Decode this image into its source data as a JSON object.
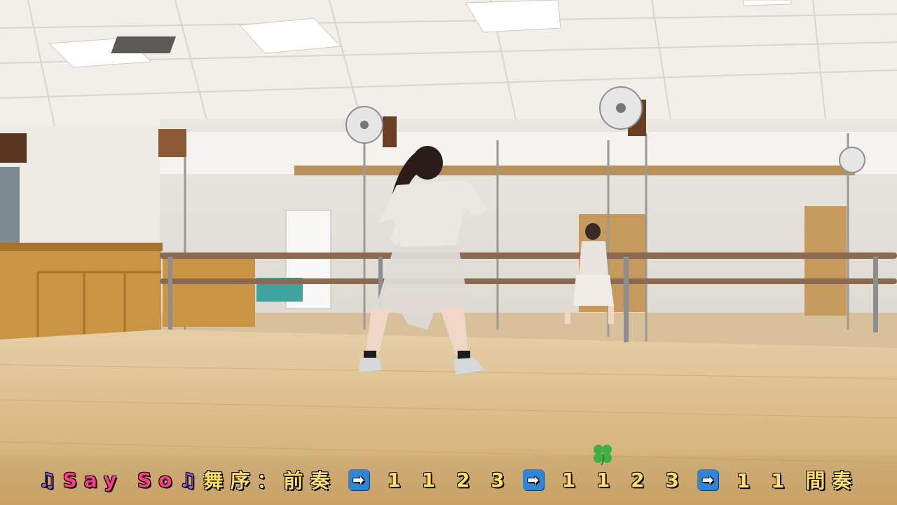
{
  "colors": {
    "ceiling": "#f1efe9",
    "wall": "#ecebe6",
    "floor": "#d9b986",
    "counter": "#c99545",
    "barre": "#8a6a50",
    "caption_text": "#ffe066",
    "caption_title": "#ff3b8a",
    "caption_note": "#9b59e6",
    "arrow_badge": "#2f86d6"
  },
  "icons": [
    "music-note-icon",
    "arrow-right-icon",
    "four-leaf-clover-icon"
  ],
  "caption": {
    "note_left": "♫",
    "title": "Say So",
    "note_right": "♫",
    "text_1": "舞序：前奏",
    "arrow_1": "➡",
    "text_2": "1 1 2 3",
    "arrow_2": "➡",
    "text_3": "1 1 2 3",
    "arrow_3": "➡",
    "text_4": "1 1 間奏"
  }
}
